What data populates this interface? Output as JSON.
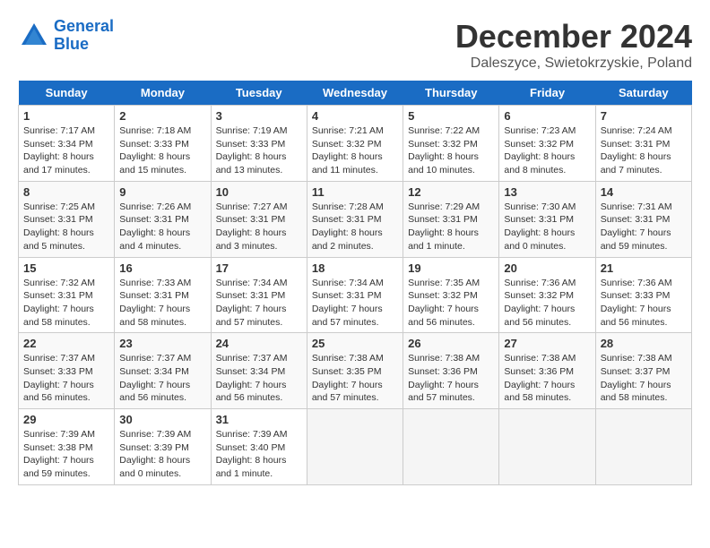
{
  "header": {
    "logo_line1": "General",
    "logo_line2": "Blue",
    "month_title": "December 2024",
    "location": "Daleszyce, Swietokrzyskie, Poland"
  },
  "days_of_week": [
    "Sunday",
    "Monday",
    "Tuesday",
    "Wednesday",
    "Thursday",
    "Friday",
    "Saturday"
  ],
  "weeks": [
    [
      {
        "day": 1,
        "sunrise": "7:17 AM",
        "sunset": "3:34 PM",
        "daylight": "8 hours and 17 minutes."
      },
      {
        "day": 2,
        "sunrise": "7:18 AM",
        "sunset": "3:33 PM",
        "daylight": "8 hours and 15 minutes."
      },
      {
        "day": 3,
        "sunrise": "7:19 AM",
        "sunset": "3:33 PM",
        "daylight": "8 hours and 13 minutes."
      },
      {
        "day": 4,
        "sunrise": "7:21 AM",
        "sunset": "3:32 PM",
        "daylight": "8 hours and 11 minutes."
      },
      {
        "day": 5,
        "sunrise": "7:22 AM",
        "sunset": "3:32 PM",
        "daylight": "8 hours and 10 minutes."
      },
      {
        "day": 6,
        "sunrise": "7:23 AM",
        "sunset": "3:32 PM",
        "daylight": "8 hours and 8 minutes."
      },
      {
        "day": 7,
        "sunrise": "7:24 AM",
        "sunset": "3:31 PM",
        "daylight": "8 hours and 7 minutes."
      }
    ],
    [
      {
        "day": 8,
        "sunrise": "7:25 AM",
        "sunset": "3:31 PM",
        "daylight": "8 hours and 5 minutes."
      },
      {
        "day": 9,
        "sunrise": "7:26 AM",
        "sunset": "3:31 PM",
        "daylight": "8 hours and 4 minutes."
      },
      {
        "day": 10,
        "sunrise": "7:27 AM",
        "sunset": "3:31 PM",
        "daylight": "8 hours and 3 minutes."
      },
      {
        "day": 11,
        "sunrise": "7:28 AM",
        "sunset": "3:31 PM",
        "daylight": "8 hours and 2 minutes."
      },
      {
        "day": 12,
        "sunrise": "7:29 AM",
        "sunset": "3:31 PM",
        "daylight": "8 hours and 1 minute."
      },
      {
        "day": 13,
        "sunrise": "7:30 AM",
        "sunset": "3:31 PM",
        "daylight": "8 hours and 0 minutes."
      },
      {
        "day": 14,
        "sunrise": "7:31 AM",
        "sunset": "3:31 PM",
        "daylight": "7 hours and 59 minutes."
      }
    ],
    [
      {
        "day": 15,
        "sunrise": "7:32 AM",
        "sunset": "3:31 PM",
        "daylight": "7 hours and 58 minutes."
      },
      {
        "day": 16,
        "sunrise": "7:33 AM",
        "sunset": "3:31 PM",
        "daylight": "7 hours and 58 minutes."
      },
      {
        "day": 17,
        "sunrise": "7:34 AM",
        "sunset": "3:31 PM",
        "daylight": "7 hours and 57 minutes."
      },
      {
        "day": 18,
        "sunrise": "7:34 AM",
        "sunset": "3:31 PM",
        "daylight": "7 hours and 57 minutes."
      },
      {
        "day": 19,
        "sunrise": "7:35 AM",
        "sunset": "3:32 PM",
        "daylight": "7 hours and 56 minutes."
      },
      {
        "day": 20,
        "sunrise": "7:36 AM",
        "sunset": "3:32 PM",
        "daylight": "7 hours and 56 minutes."
      },
      {
        "day": 21,
        "sunrise": "7:36 AM",
        "sunset": "3:33 PM",
        "daylight": "7 hours and 56 minutes."
      }
    ],
    [
      {
        "day": 22,
        "sunrise": "7:37 AM",
        "sunset": "3:33 PM",
        "daylight": "7 hours and 56 minutes."
      },
      {
        "day": 23,
        "sunrise": "7:37 AM",
        "sunset": "3:34 PM",
        "daylight": "7 hours and 56 minutes."
      },
      {
        "day": 24,
        "sunrise": "7:37 AM",
        "sunset": "3:34 PM",
        "daylight": "7 hours and 56 minutes."
      },
      {
        "day": 25,
        "sunrise": "7:38 AM",
        "sunset": "3:35 PM",
        "daylight": "7 hours and 57 minutes."
      },
      {
        "day": 26,
        "sunrise": "7:38 AM",
        "sunset": "3:36 PM",
        "daylight": "7 hours and 57 minutes."
      },
      {
        "day": 27,
        "sunrise": "7:38 AM",
        "sunset": "3:36 PM",
        "daylight": "7 hours and 58 minutes."
      },
      {
        "day": 28,
        "sunrise": "7:38 AM",
        "sunset": "3:37 PM",
        "daylight": "7 hours and 58 minutes."
      }
    ],
    [
      {
        "day": 29,
        "sunrise": "7:39 AM",
        "sunset": "3:38 PM",
        "daylight": "7 hours and 59 minutes."
      },
      {
        "day": 30,
        "sunrise": "7:39 AM",
        "sunset": "3:39 PM",
        "daylight": "8 hours and 0 minutes."
      },
      {
        "day": 31,
        "sunrise": "7:39 AM",
        "sunset": "3:40 PM",
        "daylight": "8 hours and 1 minute."
      },
      null,
      null,
      null,
      null
    ]
  ]
}
